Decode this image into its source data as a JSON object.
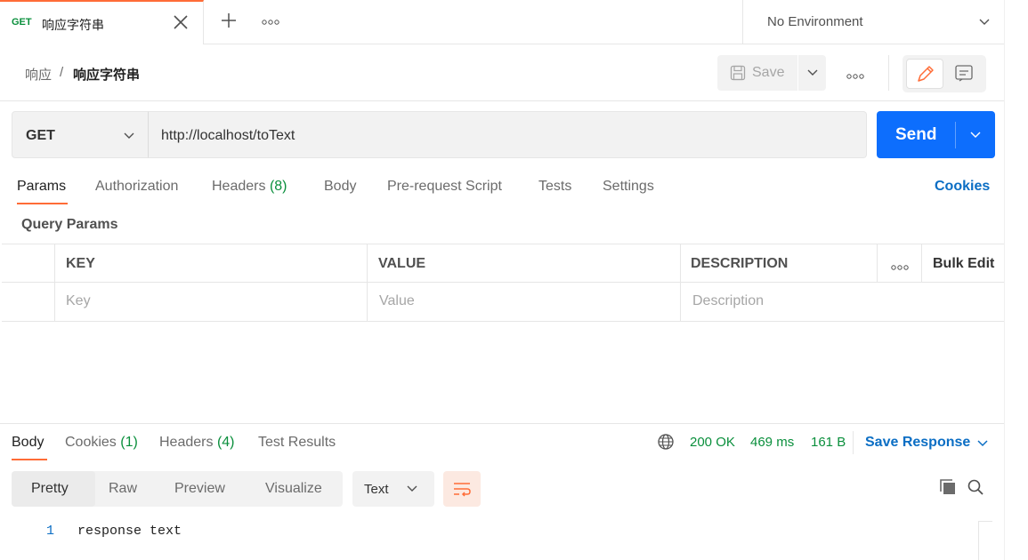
{
  "tab": {
    "method": "GET",
    "name": "响应字符串",
    "close_icon": "close-icon",
    "new_tab_icon": "plus-icon",
    "more_icon": "more-horizontal-icon"
  },
  "environment": {
    "label": "No Environment"
  },
  "breadcrumb": {
    "parent": "响应",
    "separator": "/",
    "current": "响应字符串"
  },
  "toolbar": {
    "save_label": "Save"
  },
  "request": {
    "method": "GET",
    "url": "http://localhost/toText",
    "send_label": "Send"
  },
  "request_tabs": [
    {
      "label": "Params",
      "count": ""
    },
    {
      "label": "Authorization",
      "count": ""
    },
    {
      "label": "Headers",
      "count": "(8)"
    },
    {
      "label": "Body",
      "count": ""
    },
    {
      "label": "Pre-request Script",
      "count": ""
    },
    {
      "label": "Tests",
      "count": ""
    },
    {
      "label": "Settings",
      "count": ""
    }
  ],
  "cookies_label": "Cookies",
  "query_params": {
    "title": "Query Params",
    "headers": {
      "key": "KEY",
      "value": "VALUE",
      "description": "DESCRIPTION",
      "bulk_edit": "Bulk Edit"
    },
    "placeholders": {
      "key": "Key",
      "value": "Value",
      "description": "Description"
    }
  },
  "response": {
    "tabs": [
      {
        "label": "Body",
        "count": ""
      },
      {
        "label": "Cookies",
        "count": "(1)"
      },
      {
        "label": "Headers",
        "count": "(4)"
      },
      {
        "label": "Test Results",
        "count": ""
      }
    ],
    "status": "200 OK",
    "time": "469 ms",
    "size": "161 B",
    "save_response_label": "Save Response",
    "formats": [
      "Pretty",
      "Raw",
      "Preview",
      "Visualize"
    ],
    "content_type": "Text",
    "lines": [
      {
        "number": "1",
        "text": "response text"
      }
    ]
  },
  "colors": {
    "accent": "#ff6c37",
    "primary": "#0d6efd",
    "link": "#0b6ec4",
    "success": "#0a8f3c"
  }
}
